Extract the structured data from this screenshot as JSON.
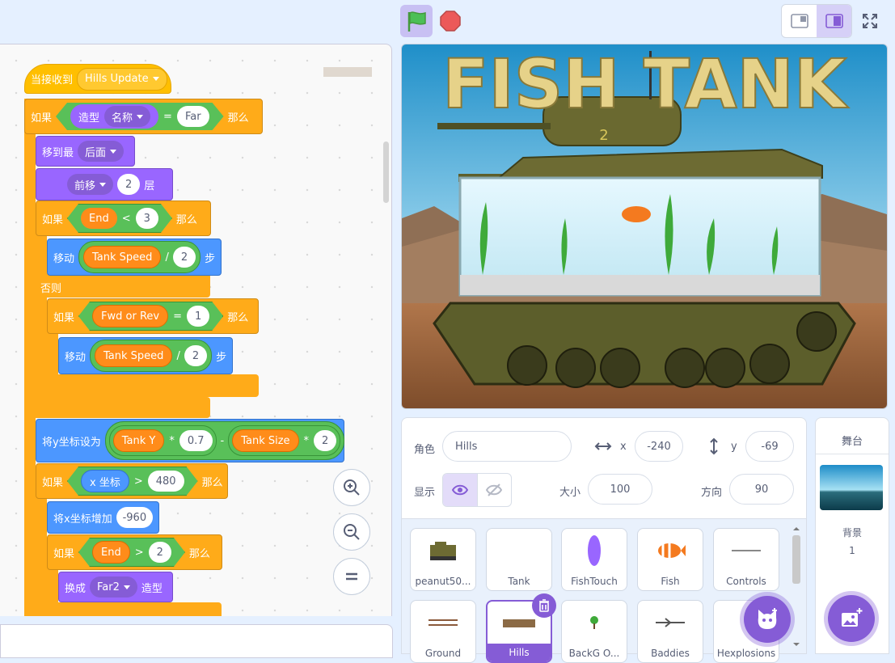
{
  "toolbar": {
    "green_flag_icon": "green-flag-icon",
    "stop_icon": "stop-icon",
    "small_stage_icon": "small-stage-icon",
    "normal_stage_icon": "normal-stage-icon",
    "fullscreen_icon": "fullscreen-icon"
  },
  "code": {
    "hat": {
      "label": "当接收到",
      "message": "Hills Update"
    },
    "if1": {
      "label": "如果",
      "reporter": "造型",
      "field": "名称",
      "op": "=",
      "value": "Far",
      "then": "那么"
    },
    "front": {
      "label": "移到最",
      "option": "后面"
    },
    "layer": {
      "option": "前移",
      "value": "2",
      "suffix": "层"
    },
    "if2": {
      "label": "如果",
      "var": "End",
      "op": "<",
      "value": "3",
      "then": "那么"
    },
    "move1": {
      "label": "移动",
      "var": "Tank Speed",
      "op": "/",
      "value": "2",
      "suffix": "步"
    },
    "else_label": "否则",
    "if3": {
      "label": "如果",
      "var": "Fwd or Rev",
      "op": "=",
      "value": "1",
      "then": "那么"
    },
    "move2": {
      "label": "移动",
      "var": "Tank Speed",
      "op": "/",
      "value": "2",
      "suffix": "步"
    },
    "sety": {
      "label": "将y坐标设为",
      "var1": "Tank Y",
      "op1": "*",
      "val1": "0.7",
      "op2": "-",
      "var2": "Tank Size",
      "op3": "*",
      "val2": "2"
    },
    "if4": {
      "label": "如果",
      "reporter": "x 坐标",
      "op": ">",
      "value": "480",
      "then": "那么"
    },
    "changex": {
      "label": "将x坐标增加",
      "value": "-960"
    },
    "if5": {
      "label": "如果",
      "var": "End",
      "op": ">",
      "value": "2",
      "then": "那么"
    },
    "costume": {
      "label": "换成",
      "option": "Far2",
      "suffix": "造型"
    }
  },
  "zoom": {
    "zoom_in_icon": "zoom-in-icon",
    "zoom_out_icon": "zoom-out-icon",
    "reset_icon": "zoom-reset-icon"
  },
  "stage": {
    "title": "FISH TANK",
    "tank_number": "2"
  },
  "sprite_info": {
    "sprite_label": "角色",
    "sprite_name": "Hills",
    "x_label": "x",
    "x_value": "-240",
    "y_label": "y",
    "y_value": "-69",
    "show_label": "显示",
    "size_label": "大小",
    "size_value": "100",
    "direction_label": "方向",
    "direction_value": "90"
  },
  "sprites": [
    {
      "name": "peanut50..."
    },
    {
      "name": "Tank"
    },
    {
      "name": "FishTouch"
    },
    {
      "name": "Fish"
    },
    {
      "name": "Controls"
    },
    {
      "name": "Ground"
    },
    {
      "name": "Hills"
    },
    {
      "name": "BackG O..."
    },
    {
      "name": "Baddies"
    },
    {
      "name": "Hexplosions"
    }
  ],
  "stage_panel": {
    "title": "舞台",
    "backdrop_label": "背景",
    "backdrop_count": "1"
  },
  "colors": {
    "accent": "#855cd6",
    "events": "#ffbf00",
    "control": "#ffab19",
    "looks": "#9966ff",
    "motion": "#4c97ff",
    "operators": "#59c059",
    "variables": "#ff8c1a"
  }
}
